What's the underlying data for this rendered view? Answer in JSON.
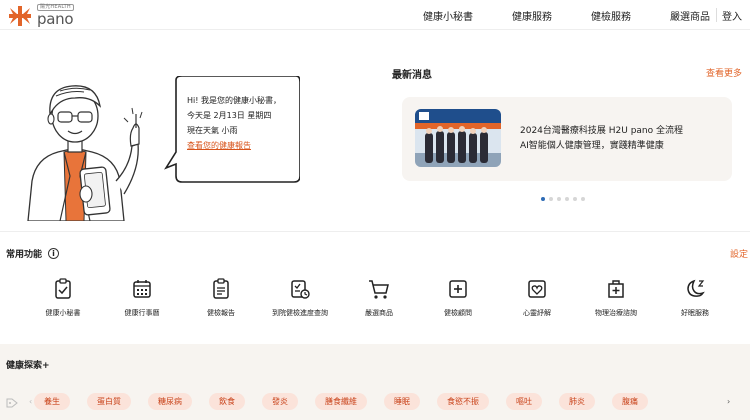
{
  "header": {
    "logo_small": "陽光HEALTH",
    "logo_name": "pano",
    "nav": [
      "健康小秘書",
      "健康服務",
      "健檢服務",
      "嚴選商品"
    ],
    "login": "登入",
    "brand_color": "#e2652a"
  },
  "assistant": {
    "line1": "Hi! 我是您的健康小秘書，",
    "line2": "今天是 2月13日 星期四",
    "line3": "現在天氣 小雨",
    "report_link": "查看您的健康報告"
  },
  "news": {
    "title": "最新消息",
    "more": "查看更多",
    "card_line1": "2024台灣醫療科技展 H2U pano 全流程",
    "card_line2": "AI智能個人健康管理，實踐精準健康",
    "dots_count": 6,
    "active_dot": 1
  },
  "functions": {
    "title": "常用功能",
    "settings": "設定",
    "items": [
      {
        "label": "健康小秘書",
        "icon": "clipboard-check-icon"
      },
      {
        "label": "健康行事曆",
        "icon": "calendar-icon"
      },
      {
        "label": "健檢報告",
        "icon": "report-icon"
      },
      {
        "label": "到院健檢進度查詢",
        "icon": "progress-query-icon"
      },
      {
        "label": "嚴選商品",
        "icon": "shopping-cart-icon"
      },
      {
        "label": "健檢顧問",
        "icon": "medical-cross-icon"
      },
      {
        "label": "心靈紓解",
        "icon": "heart-icon"
      },
      {
        "label": "物理治療諮詢",
        "icon": "medical-bag-icon"
      },
      {
        "label": "好眠服務",
        "icon": "moon-icon"
      }
    ]
  },
  "explore": {
    "title": "健康探索+",
    "tags": [
      "養生",
      "蛋白質",
      "糖尿病",
      "飲食",
      "發炎",
      "膳食纖維",
      "睡眠",
      "食慾不振",
      "嘔吐",
      "肺炎",
      "腹痛"
    ]
  }
}
